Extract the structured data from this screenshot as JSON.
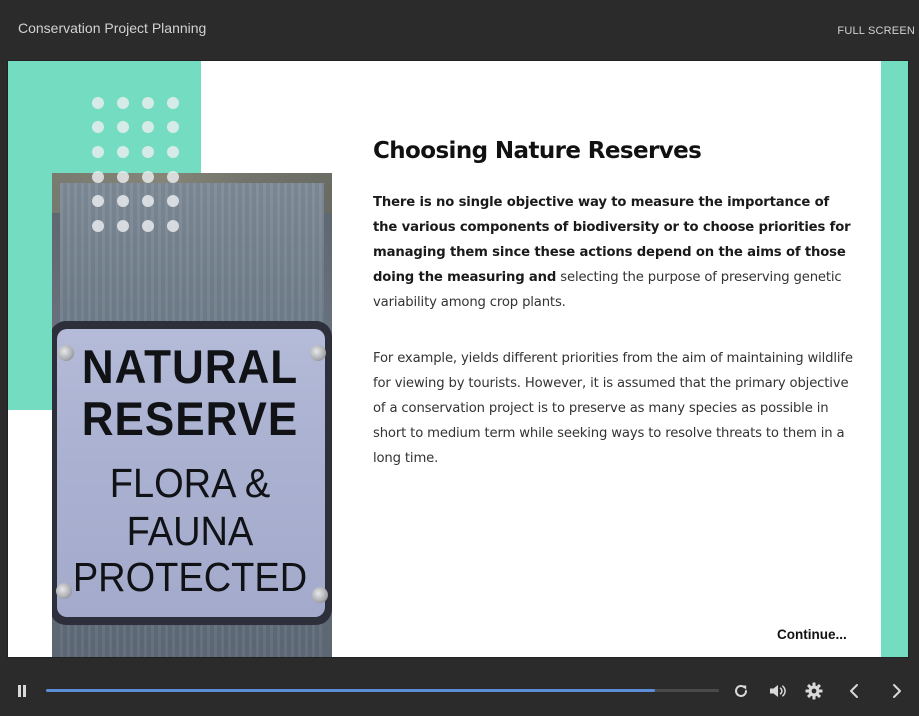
{
  "header": {
    "course_title": "Conservation Project Planning",
    "fullscreen_label": "FULL SCREEN"
  },
  "slide": {
    "title": "Choosing Nature Reserves",
    "paragraph1_bold": "There is no single objective way to measure the importance of the various components of biodiversity or to choose priorities for managing them since these actions depend on the aims of those doing the measuring and",
    "paragraph1_rest": " selecting the purpose of preserving genetic variability among crop plants.",
    "paragraph2": "For example, yields different priorities from the aim of maintaining wildlife for viewing by tourists. However, it is assumed that the primary objective of a conservation project is to preserve as many species as possible in short to medium term while seeking ways to resolve threats to them in a long time.",
    "continue_label": "Continue...",
    "image": {
      "sign_lines": [
        "NATURAL",
        "RESERVE",
        "FLORA &",
        "FAUNA",
        "PROTECTED"
      ]
    }
  },
  "colors": {
    "accent_teal": "#74dcc1",
    "progress_blue": "#5b8ed6",
    "chrome_dark": "#2b2b2b"
  },
  "player": {
    "progress_fraction": 0.905,
    "icons": [
      "pause-icon",
      "replay-icon",
      "volume-icon",
      "settings-gear-icon",
      "previous-chevron-icon",
      "next-chevron-icon"
    ]
  }
}
